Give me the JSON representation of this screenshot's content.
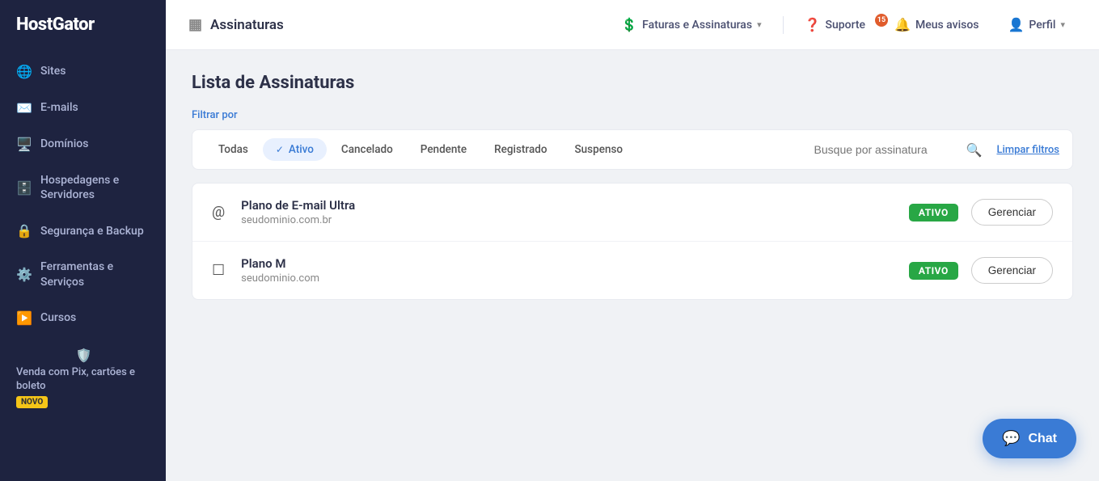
{
  "sidebar": {
    "logo": "HostGator",
    "items": [
      {
        "id": "sites",
        "label": "Sites",
        "icon": "🌐"
      },
      {
        "id": "emails",
        "label": "E-mails",
        "icon": "✉️"
      },
      {
        "id": "dominios",
        "label": "Domínios",
        "icon": "🖥️"
      },
      {
        "id": "hospedagens",
        "label": "Hospedagens e Servidores",
        "icon": "🗄️"
      },
      {
        "id": "seguranca",
        "label": "Segurança e Backup",
        "icon": "🔒"
      },
      {
        "id": "ferramentas",
        "label": "Ferramentas e Serviços",
        "icon": "⚙️"
      },
      {
        "id": "cursos",
        "label": "Cursos",
        "icon": "▶️"
      }
    ],
    "promo": {
      "text": "Venda com Pix, cartões e boleto",
      "badge": "NOVO",
      "icon": "🛡️"
    }
  },
  "header": {
    "page_title": "Assinaturas",
    "page_icon": "📋",
    "nav_items": [
      {
        "id": "faturas",
        "label": "Faturas e Assinaturas",
        "icon": "💲",
        "has_dropdown": true
      },
      {
        "id": "suporte",
        "label": "Suporte",
        "icon": "❓",
        "has_dropdown": false
      },
      {
        "id": "avisos",
        "label": "Meus avisos",
        "icon": "🔔",
        "has_dropdown": false,
        "badge": "15"
      },
      {
        "id": "perfil",
        "label": "Perfil",
        "icon": "👤",
        "has_dropdown": true
      }
    ]
  },
  "content": {
    "page_heading": "Lista de Assinaturas",
    "filter_label": "Filtrar por",
    "filters": [
      {
        "id": "todas",
        "label": "Todas",
        "active": false
      },
      {
        "id": "ativo",
        "label": "Ativo",
        "active": true
      },
      {
        "id": "cancelado",
        "label": "Cancelado",
        "active": false
      },
      {
        "id": "pendente",
        "label": "Pendente",
        "active": false
      },
      {
        "id": "registrado",
        "label": "Registrado",
        "active": false
      },
      {
        "id": "suspenso",
        "label": "Suspenso",
        "active": false
      }
    ],
    "search_placeholder": "Busque por assinatura",
    "clear_filters_label": "Limpar filtros",
    "subscriptions": [
      {
        "id": "plano-email-ultra",
        "icon": "@",
        "name": "Plano de E-mail Ultra",
        "domain": "seudominio.com.br",
        "status": "ATIVO",
        "manage_label": "Gerenciar"
      },
      {
        "id": "plano-m",
        "icon": "☐",
        "name": "Plano M",
        "domain": "seudominio.com",
        "status": "ATIVO",
        "manage_label": "Gerenciar"
      }
    ]
  },
  "chat": {
    "label": "Chat",
    "icon": "💬"
  }
}
